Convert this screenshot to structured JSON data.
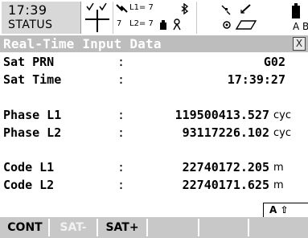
{
  "status": {
    "time": "17:39",
    "label": "STATUS",
    "l1_sats": "L1= 7",
    "l2_sats": "L2= 7",
    "sat_count": "7",
    "battery_label": "A",
    "memory_label": "B"
  },
  "title": {
    "text": "Real-Time Input Data",
    "close_label": "X"
  },
  "rows": [
    {
      "label": "Sat PRN",
      "sep": ":",
      "value": "G02",
      "unit": ""
    },
    {
      "label": "Sat Time",
      "sep": ":",
      "value": "17:39:27",
      "unit": ""
    },
    {
      "label": "Phase L1",
      "sep": ":",
      "value": "119500413.527",
      "unit": "cyc"
    },
    {
      "label": "Phase L2",
      "sep": ":",
      "value": "93117226.102",
      "unit": "cyc"
    },
    {
      "label": "Code L1",
      "sep": ":",
      "value": "22740172.205",
      "unit": "m"
    },
    {
      "label": "Code L2",
      "sep": ":",
      "value": "22740171.625",
      "unit": "m"
    }
  ],
  "mode_indicator": "A ⇧",
  "softkeys": [
    {
      "label": "CONT",
      "enabled": true
    },
    {
      "label": "SAT-",
      "enabled": false
    },
    {
      "label": "SAT+",
      "enabled": true
    },
    {
      "label": "",
      "enabled": false
    },
    {
      "label": "",
      "enabled": false
    },
    {
      "label": "",
      "enabled": false
    }
  ]
}
